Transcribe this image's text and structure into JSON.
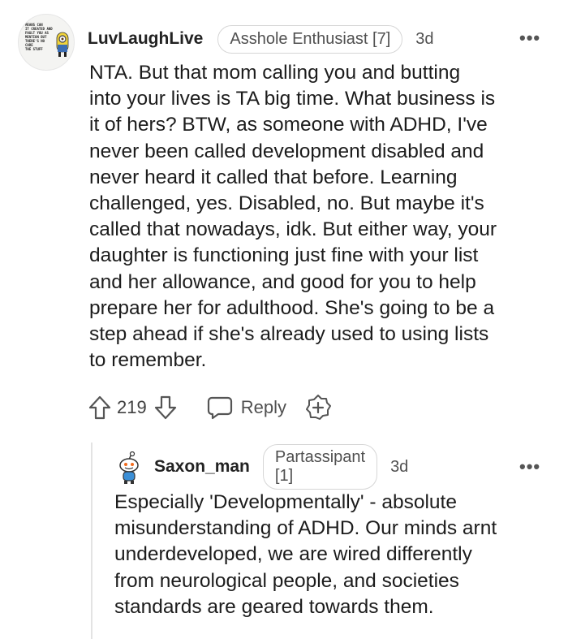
{
  "comment": {
    "username": "LuvLaughLive",
    "flair": "Asshole Enthusiast [7]",
    "age": "3d",
    "more": "•••",
    "avatar_text": "MEANS CAN\nIT CREATED AND\nFAULT YOU AS\nMENTION BUT\nTHERE'S NO CARE\nTHE STUFF",
    "body_lines": [
      "NTA. But that mom calling you and butting",
      "into your lives is TA big time. What business is",
      "it of hers? BTW, as someone with ADHD, I've",
      "never been called development disabled and",
      "never heard it called that before. Learning",
      "challenged, yes. Disabled, no. But maybe it's",
      "called that nowadays, idk. But either way, your",
      "daughter is functioning just fine with your list",
      "and her allowance, and good for you to help",
      "prepare her for adulthood. She's going to be a",
      "step ahead if she's already used to using lists",
      "to remember."
    ],
    "score": "219",
    "reply_label": "Reply",
    "icons": [
      "upvote-icon",
      "downvote-icon",
      "reply-icon",
      "award-icon",
      "more-icon"
    ]
  },
  "reply": {
    "username": "Saxon_man",
    "flair": "Partassipant [1]",
    "age": "3d",
    "more": "•••",
    "body_lines": [
      "Especially 'Developmentally' - absolute",
      "misunderstanding of ADHD. Our minds arnt",
      "underdeveloped, we are wired differently",
      "from neurological people, and societies",
      "standards are geared towards them."
    ]
  },
  "colors": {
    "text": "#1c1c1c",
    "meta": "#505050",
    "border": "#d6d6d6",
    "thread": "#e3e3e3"
  }
}
